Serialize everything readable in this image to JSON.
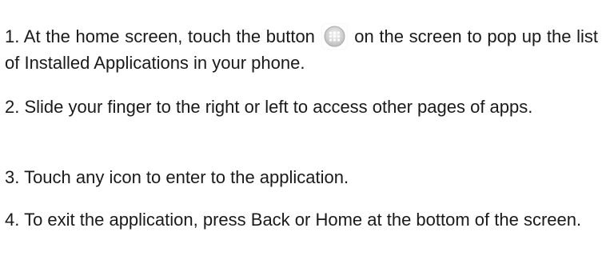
{
  "steps": [
    {
      "before": "1. At the home screen, touch the button ",
      "icon": "apps-grid-icon",
      "after": " on the screen to pop up the list of Installed Applications in your phone."
    },
    {
      "text": "2. Slide your finger to the right or left to access other pages of apps."
    },
    {
      "text": "3. Touch any icon to enter to the application."
    },
    {
      "text": "4. To exit the application, press Back or Home at the bottom of the screen."
    }
  ]
}
